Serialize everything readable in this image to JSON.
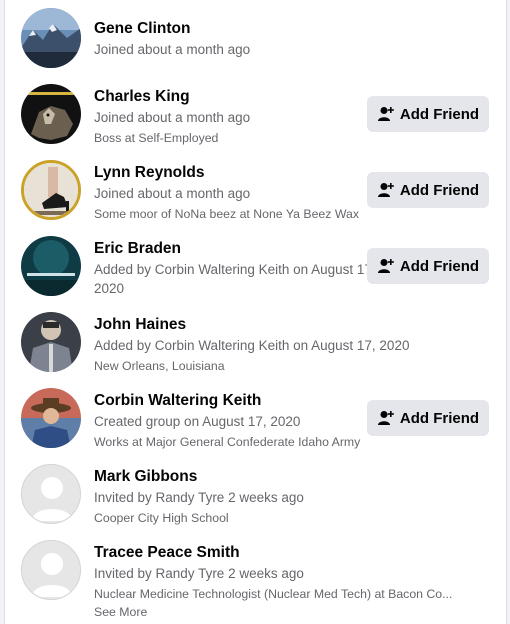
{
  "members": [
    {
      "name": "Gene Clinton",
      "line2": "Joined about a month ago",
      "line3": "",
      "button": "",
      "avatar": "mountain-photo"
    },
    {
      "name": "Charles King",
      "line2": "Joined about a month ago",
      "line3": "Boss at Self-Employed",
      "button": "Add Friend",
      "avatar": "wolf-photo"
    },
    {
      "name": "Lynn Reynolds",
      "line2": "Joined about a month ago",
      "line3": "Some moor of NoNa beez at None Ya Beez Wax",
      "button": "Add Friend",
      "avatar": "shoe-photo"
    },
    {
      "name": "Eric Braden",
      "line2": "Added by Corbin Waltering Keith on August 17, 2020",
      "line3": "",
      "button": "Add Friend",
      "avatar": "underwater-photo"
    },
    {
      "name": "John Haines",
      "line2": "Added by Corbin Waltering Keith on August 17, 2020",
      "line3": "New Orleans, Louisiana",
      "button": "",
      "avatar": "soldier-photo"
    },
    {
      "name": "Corbin Waltering Keith",
      "line2": "Created group on August 17, 2020",
      "line3": "Works at Major General Confederate Idaho Army",
      "button": "Add Friend",
      "avatar": "cowboy-photo"
    },
    {
      "name": "Mark Gibbons",
      "line2": "Invited by Randy Tyre 2 weeks ago",
      "line3": "Cooper City High School",
      "button": "",
      "avatar": "default-avatar"
    },
    {
      "name": "Tracee Peace Smith",
      "line2": "Invited by Randy Tyre 2 weeks ago",
      "line3": "Nuclear Medicine Technologist (Nuclear Med Tech) at Bacon Co... See More",
      "button": "",
      "avatar": "default-avatar"
    }
  ],
  "colors": {
    "button_bg": "#e4e6eb",
    "secondary_text": "#65676b",
    "primary_text": "#050505"
  }
}
